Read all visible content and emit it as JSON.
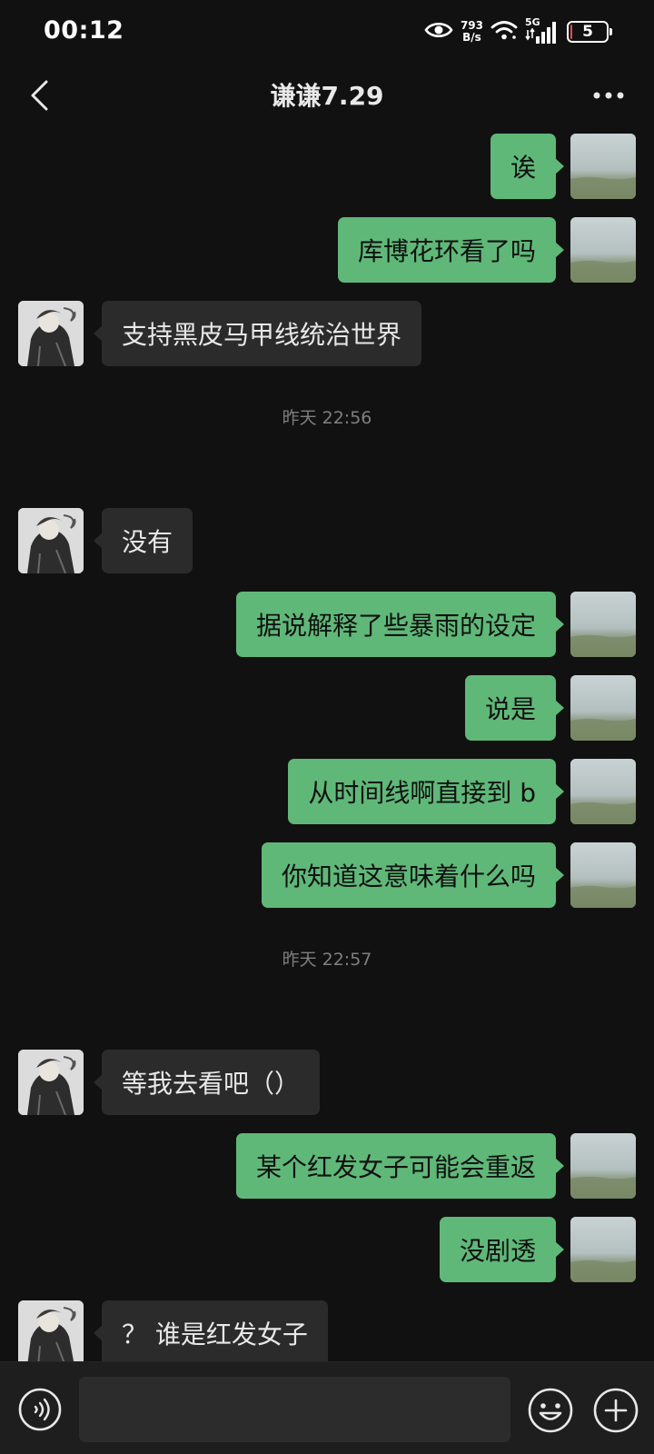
{
  "status_bar": {
    "time": "00:12",
    "net_speed_value": "793",
    "net_speed_unit": "B/s",
    "network_type": "5G",
    "battery_level": "5",
    "battery_fraction": 0.05,
    "icons": [
      "eye-icon",
      "wifi-icon",
      "signal-icon",
      "battery-icon"
    ]
  },
  "header": {
    "title": "谦谦7.29",
    "back_icon": "chevron-left-icon",
    "more_icon": "more-dots-icon"
  },
  "messages": [
    {
      "sender": "me",
      "text": "诶"
    },
    {
      "sender": "me",
      "text": "库博花环看了吗"
    },
    {
      "sender": "other",
      "text": "支持黑皮马甲线统治世界"
    },
    {
      "sender": "time",
      "text": "昨天 22:56"
    },
    {
      "sender": "other",
      "text": "没有"
    },
    {
      "sender": "me",
      "text": "据说解释了些暴雨的设定"
    },
    {
      "sender": "me",
      "text": "说是"
    },
    {
      "sender": "me",
      "text": "从时间线啊直接到 b"
    },
    {
      "sender": "me",
      "text": "你知道这意味着什么吗"
    },
    {
      "sender": "time",
      "text": "昨天 22:57"
    },
    {
      "sender": "other",
      "text": "等我去看吧（）"
    },
    {
      "sender": "me",
      "text": "某个红发女子可能会重返"
    },
    {
      "sender": "me",
      "text": "没剧透"
    },
    {
      "sender": "other",
      "text": "？ 谁是红发女子"
    }
  ],
  "input_bar": {
    "message_value": "",
    "icons": [
      "voice-icon",
      "emoji-icon",
      "plus-icon"
    ]
  },
  "colors": {
    "background": "#111111",
    "outgoing_bubble": "#5fb878",
    "incoming_bubble": "#2b2b2b",
    "timestamp_text": "#7f7f7f",
    "input_bar": "#1e1e1e"
  }
}
